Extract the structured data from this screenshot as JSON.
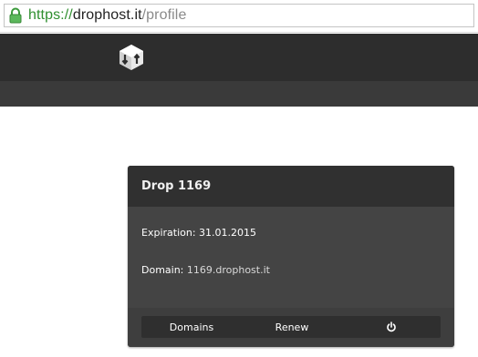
{
  "browser": {
    "url_scheme": "https://",
    "url_host": "drophost.it",
    "url_path": "/profile",
    "lock_icon": "padlock-icon"
  },
  "header": {
    "logo_icon": "drophost-cube-logo"
  },
  "card": {
    "title": "Drop 1169",
    "expiration_label": "Expiration: 31.01.2015",
    "domain_label": "Domain: ",
    "domain_value": "1169.drophost.it",
    "actions": {
      "domains": "Domains",
      "renew": "Renew",
      "power_icon": "power-icon"
    }
  },
  "colors": {
    "header_bg": "#2d2d2d",
    "subbar_bg": "#3a3a3a",
    "card_bg": "#444444",
    "card_header_bg": "#303030",
    "secure_green": "#2f8f2f"
  }
}
